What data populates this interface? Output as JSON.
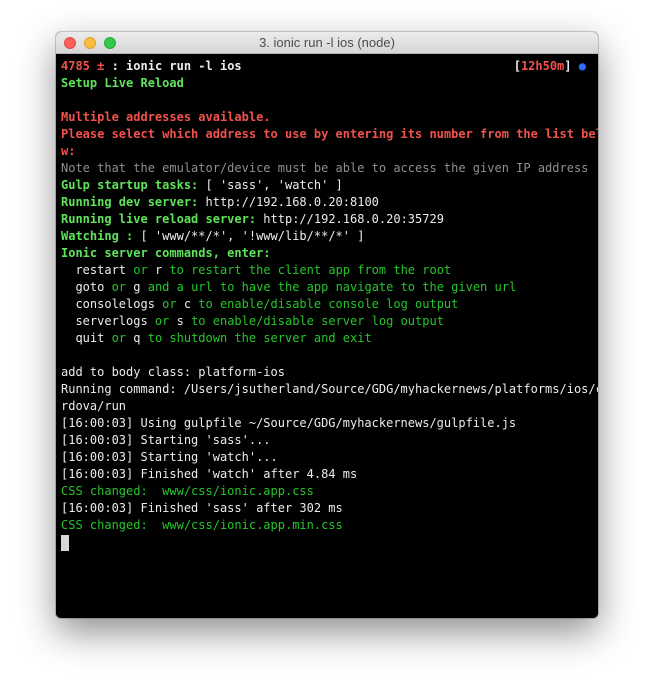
{
  "window": {
    "title": "3. ionic run -l ios (node)"
  },
  "prompt": {
    "pid": "4785",
    "symbol": "±",
    "command": ": ionic run -l ios",
    "timer_open": "[",
    "timer": "12h50m",
    "timer_close": "]",
    "dot": "●"
  },
  "lines": {
    "setup": "Setup Live Reload",
    "multi": "Multiple addresses available.",
    "select1": "Please select which address to use by entering its number from the list belo",
    "select2": "w:",
    "note": "Note that the emulator/device must be able to access the given IP address",
    "gulp_label": "Gulp startup tasks:",
    "gulp_value": " [ 'sass', 'watch' ]",
    "dev_label": "Running dev server:",
    "dev_value": " http://192.168.0.20:8100",
    "live_label": "Running live reload server:",
    "live_value": " http://192.168.0.20:35729",
    "watch_label": "Watching :",
    "watch_value": " [ 'www/**/*', '!www/lib/**/*' ]",
    "cmds_header": "Ionic server commands, enter:",
    "cmd_restart_key": "  restart",
    "cmd_restart_or": " or ",
    "cmd_restart_short": "r",
    "cmd_restart_desc": " to restart the client app from the root",
    "cmd_goto_key": "  goto",
    "cmd_goto_or": " or ",
    "cmd_goto_short": "g",
    "cmd_goto_desc": " and a url to have the app navigate to the given url",
    "cmd_console_key": "  consolelogs",
    "cmd_console_or": " or ",
    "cmd_console_short": "c",
    "cmd_console_desc": " to enable/disable console log output",
    "cmd_server_key": "  serverlogs",
    "cmd_server_or": " or ",
    "cmd_server_short": "s",
    "cmd_server_desc": " to enable/disable server log output",
    "cmd_quit_key": "  quit",
    "cmd_quit_or": " or ",
    "cmd_quit_short": "q",
    "cmd_quit_desc": " to shutdown the server and exit",
    "body_class": "add to body class: platform-ios",
    "running_cmd1": "Running command: /Users/jsutherland/Source/GDG/myhackernews/platforms/ios/co",
    "running_cmd2": "rdova/run",
    "log1": "[16:00:03] Using gulpfile ~/Source/GDG/myhackernews/gulpfile.js",
    "log2": "[16:00:03] Starting 'sass'...",
    "log3": "[16:00:03] Starting 'watch'...",
    "log4": "[16:00:03] Finished 'watch' after 4.84 ms",
    "css1": "CSS changed:  www/css/ionic.app.css",
    "log5": "[16:00:03] Finished 'sass' after 302 ms",
    "css2": "CSS changed:  www/css/ionic.app.min.css"
  }
}
